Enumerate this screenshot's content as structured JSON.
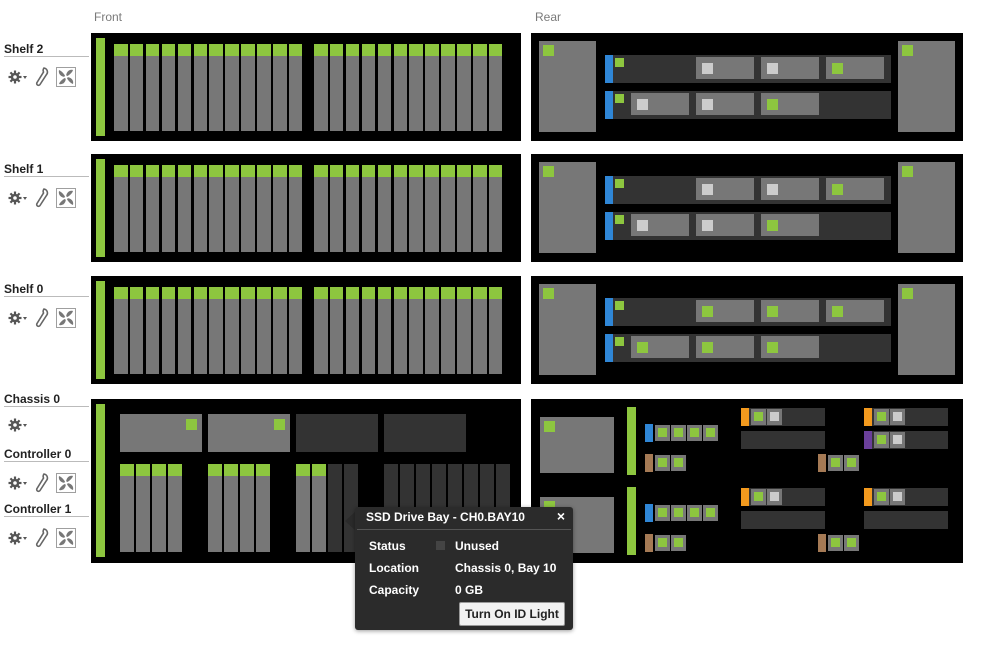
{
  "columns": {
    "front": "Front",
    "rear": "Rear"
  },
  "shelves": [
    {
      "label": "Shelf 2"
    },
    {
      "label": "Shelf 1"
    },
    {
      "label": "Shelf 0"
    }
  ],
  "chassis": {
    "label": "Chassis 0"
  },
  "controllers": [
    {
      "label": "Controller 0"
    },
    {
      "label": "Controller 1"
    }
  ],
  "icons": {
    "settings": "gear-icon",
    "wrench": "wrench-icon",
    "fan": "fan-icon"
  },
  "colors": {
    "status_ok": "#8dc63f",
    "panel": "#000000",
    "disk": "#777777",
    "port_blue": "#2f86d6",
    "port_orange": "#f39a1e",
    "port_purple": "#6a3f9a",
    "port_brown": "#a57a55"
  },
  "tooltip": {
    "title": "SSD Drive Bay - CH0.BAY10",
    "close": "×",
    "status_label": "Status",
    "status_value": "Unused",
    "location_label": "Location",
    "location_value": "Chassis 0, Bay 10",
    "capacity_label": "Capacity",
    "capacity_value": "0 GB",
    "button": "Turn On ID Light"
  }
}
